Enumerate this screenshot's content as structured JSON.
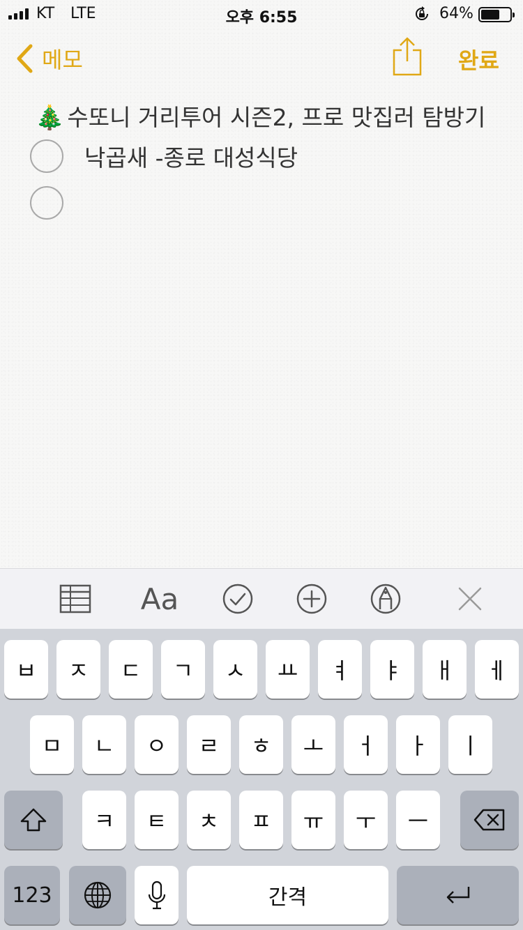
{
  "status_bar": {
    "carrier": "KT",
    "network": "LTE",
    "time": "오후 6:55",
    "battery_percent": "64%",
    "battery_level": 0.64
  },
  "nav": {
    "back_label": "메모",
    "done_label": "완료"
  },
  "note": {
    "title_emoji": "🎄",
    "title": "수또니 거리투어 시즌2, 프로 맛집러 탐방기",
    "checklist": [
      {
        "text": "낙곱새 -종로 대성식당",
        "checked": false
      },
      {
        "text": "",
        "checked": false
      }
    ]
  },
  "toolbar": {
    "items": [
      "table-icon",
      "Aa",
      "checklist-icon",
      "add-icon",
      "markup-icon",
      "close-icon"
    ],
    "format_label": "Aa"
  },
  "keyboard": {
    "row1": [
      "ㅂ",
      "ㅈ",
      "ㄷ",
      "ㄱ",
      "ㅅ",
      "ㅛ",
      "ㅕ",
      "ㅑ",
      "ㅐ",
      "ㅔ"
    ],
    "row2": [
      "ㅁ",
      "ㄴ",
      "ㅇ",
      "ㄹ",
      "ㅎ",
      "ㅗ",
      "ㅓ",
      "ㅏ",
      "ㅣ"
    ],
    "row3": [
      "ㅋ",
      "ㅌ",
      "ㅊ",
      "ㅍ",
      "ㅠ",
      "ㅜ",
      "ㅡ"
    ],
    "numbers_label": "123",
    "space_label": "간격"
  },
  "colors": {
    "accent": "#e0a816",
    "paper": "#f7f7f6",
    "keyboard_bg": "#d1d4da"
  }
}
